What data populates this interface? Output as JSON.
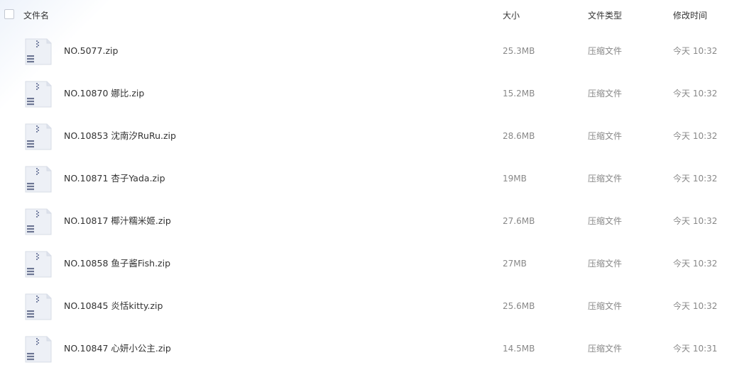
{
  "header": {
    "name": "文件名",
    "size": "大小",
    "type": "文件类型",
    "modified": "修改时间"
  },
  "files": [
    {
      "name": "NO.5077.zip",
      "size": "25.3MB",
      "type": "压缩文件",
      "modified": "今天 10:32",
      "icon": "zip-file-icon"
    },
    {
      "name": "NO.10870 娜比.zip",
      "size": "15.2MB",
      "type": "压缩文件",
      "modified": "今天 10:32",
      "icon": "zip-file-icon"
    },
    {
      "name": "NO.10853 沈南汐RuRu.zip",
      "size": "28.6MB",
      "type": "压缩文件",
      "modified": "今天 10:32",
      "icon": "zip-file-icon"
    },
    {
      "name": "NO.10871 杏子Yada.zip",
      "size": "19MB",
      "type": "压缩文件",
      "modified": "今天 10:32",
      "icon": "zip-file-icon"
    },
    {
      "name": "NO.10817 椰汁糯米姬.zip",
      "size": "27.6MB",
      "type": "压缩文件",
      "modified": "今天 10:32",
      "icon": "zip-file-icon"
    },
    {
      "name": "NO.10858 鱼子酱Fish.zip",
      "size": "27MB",
      "type": "压缩文件",
      "modified": "今天 10:32",
      "icon": "zip-file-icon"
    },
    {
      "name": "NO.10845 炎恬kitty.zip",
      "size": "25.6MB",
      "type": "压缩文件",
      "modified": "今天 10:32",
      "icon": "zip-file-icon"
    },
    {
      "name": "NO.10847 心妍小公主.zip",
      "size": "14.5MB",
      "type": "压缩文件",
      "modified": "今天 10:31",
      "icon": "zip-file-icon"
    }
  ]
}
